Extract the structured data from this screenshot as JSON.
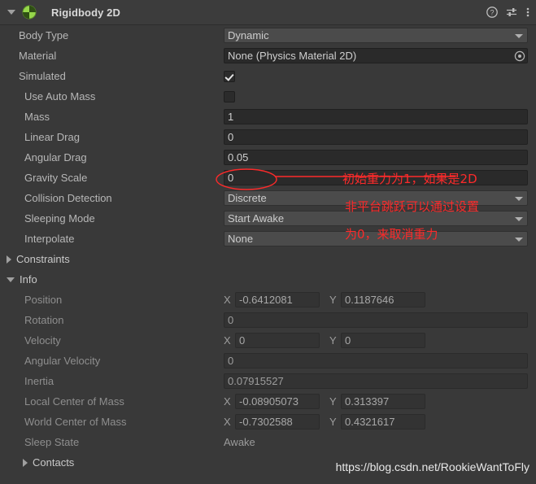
{
  "header": {
    "title": "Rigidbody 2D",
    "icon": "rigidbody2d-icon",
    "foldout_state": "expanded",
    "help_icon": "help-icon",
    "preset_icon": "preset-icon",
    "menu_icon": "kebab-menu-icon"
  },
  "properties": [
    {
      "label": "Body Type",
      "type": "popup",
      "value": "Dynamic"
    },
    {
      "label": "Material",
      "type": "object",
      "value": "None (Physics Material 2D)"
    },
    {
      "label": "Simulated",
      "type": "checkbox",
      "value": "checked"
    },
    {
      "label": "Use Auto Mass",
      "type": "checkbox",
      "value": "unchecked"
    },
    {
      "label": "Mass",
      "type": "text",
      "value": "1"
    },
    {
      "label": "Linear Drag",
      "type": "text",
      "value": "0"
    },
    {
      "label": "Angular Drag",
      "type": "text",
      "value": "0.05"
    },
    {
      "label": "Gravity Scale",
      "type": "text",
      "value": "0"
    },
    {
      "label": "Collision Detection",
      "type": "popup",
      "value": "Discrete"
    },
    {
      "label": "Sleeping Mode",
      "type": "popup",
      "value": "Start Awake"
    },
    {
      "label": "Interpolate",
      "type": "popup",
      "value": "None"
    }
  ],
  "constraints": {
    "label": "Constraints",
    "foldout_state": "collapsed"
  },
  "info": {
    "label": "Info",
    "foldout_state": "expanded",
    "rows": [
      {
        "label": "Position",
        "type": "vector2",
        "x": "-0.6412081",
        "y": "0.1187646"
      },
      {
        "label": "Rotation",
        "type": "text",
        "value": "0"
      },
      {
        "label": "Velocity",
        "type": "vector2",
        "x": "0",
        "y": "0"
      },
      {
        "label": "Angular Velocity",
        "type": "text",
        "value": "0"
      },
      {
        "label": "Inertia",
        "type": "text",
        "value": "0.07915527"
      },
      {
        "label": "Local Center of Mass",
        "type": "vector2",
        "x": "-0.08905073",
        "y": "0.313397"
      },
      {
        "label": "World Center of Mass",
        "type": "vector2",
        "x": "-0.7302588",
        "y": "0.4321617"
      },
      {
        "label": "Sleep State",
        "type": "plain",
        "value": "Awake"
      }
    ],
    "contacts": {
      "label": "Contacts",
      "foldout_state": "collapsed"
    }
  },
  "axis_labels": {
    "x": "X",
    "y": "Y"
  },
  "annotation": {
    "color": "#fc2a2a",
    "lines": [
      "初始重力为1，如果是2D",
      "非平台跳跃可以通过设置",
      "为0，来取消重力"
    ]
  },
  "watermark": "https://blog.csdn.net/RookieWantToFly",
  "colors": {
    "panel_bg": "#393939",
    "header_bg": "#3c3c3c",
    "field_bg": "#2a2a2a",
    "popup_bg": "#4b4b4b",
    "label_text": "#b7b7b7",
    "dim_text": "#8e8e8e",
    "icon_green": "#96d64b",
    "annotation_red": "#fc2a2a"
  }
}
